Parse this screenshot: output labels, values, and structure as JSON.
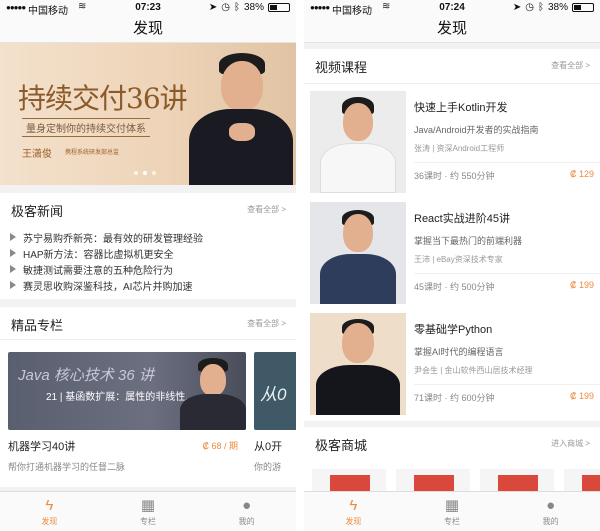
{
  "status_left": {
    "carrier": "中国移动",
    "time": "07:23",
    "battery": "38%"
  },
  "status_right": {
    "carrier": "中国移动",
    "time": "07:24",
    "battery": "38%"
  },
  "discover_title": "发现",
  "banner": {
    "title": "持续交付36讲",
    "subtitle": "量身定制你的持续交付体系",
    "author": "王潇俊",
    "author_role": "携程系统研发部总监"
  },
  "news": {
    "title": "极客新闻",
    "more": "查看全部 >",
    "items": [
      "苏宁易购乔新亮：最有效的研发管理经验",
      "HAP新方法：容器比虚拟机更安全",
      "敏捷测试需要注意的五种危险行为",
      "赛灵思收购深鉴科技，AI芯片并购加速"
    ]
  },
  "columns": {
    "title": "精品专栏",
    "more": "查看全部 >",
    "cards": [
      {
        "cover_title": "Java 核心技术 36 讲",
        "cover_sub": "21 | 基函数扩展：属性的非线性...",
        "title": "机器学习40讲",
        "price": "₡ 68 / 期",
        "desc": "帮你打通机器学习的任督二脉"
      },
      {
        "cover_title": "从0",
        "title": "从0开",
        "desc": "你的游"
      }
    ]
  },
  "videos": {
    "title": "视频课程",
    "more": "查看全部 >",
    "items": [
      {
        "title": "快速上手Kotlin开发",
        "desc": "Java/Android开发者的实战指南",
        "author": "张涛 | 资深Android工程师",
        "meta": "36课时 · 约 550分钟",
        "price": "₡ 129"
      },
      {
        "title": "React实战进阶45讲",
        "desc": "掌握当下最热门的前端利器",
        "author": "王沛 | eBay资深技术专家",
        "meta": "45课时 · 约 500分钟",
        "price": "₡ 199"
      },
      {
        "title": "零基础学Python",
        "desc": "掌握AI时代的编程语言",
        "author": "尹会生 | 金山软件西山居技术经理",
        "meta": "71课时 · 约 600分钟",
        "price": "₡ 199"
      }
    ]
  },
  "shop": {
    "title": "极客商城",
    "more": "进入商城 >"
  },
  "tabs": [
    {
      "label": "发现"
    },
    {
      "label": "专栏"
    },
    {
      "label": "我的"
    }
  ],
  "colors": {
    "accent": "#f08a3c",
    "background": "#f2f2f2"
  }
}
